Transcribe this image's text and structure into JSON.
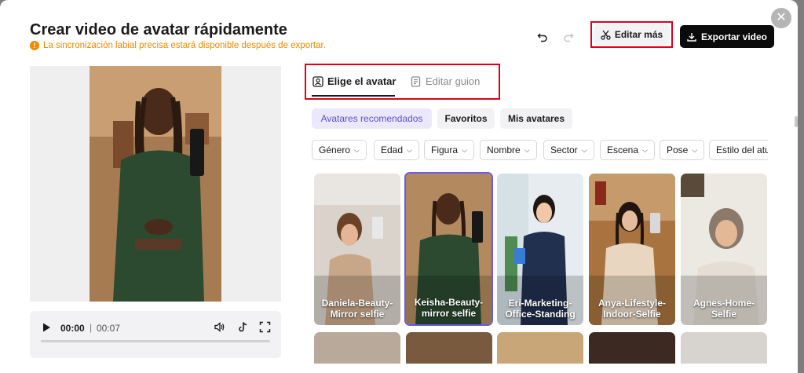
{
  "header": {
    "title": "Crear video de avatar rápidamente",
    "warning": "La sincronización labial precisa estará disponible después de exportar.",
    "edit_more_label": "Editar más",
    "export_label": "Exportar video"
  },
  "player": {
    "current_time": "00:00",
    "separator": "|",
    "total_time": "00:07",
    "progress": 0
  },
  "tabs": [
    {
      "label": "Elige el avatar",
      "active": true
    },
    {
      "label": "Editar guion",
      "active": false
    }
  ],
  "categories": [
    {
      "label": "Avatares recomendados",
      "active": true
    },
    {
      "label": "Favoritos",
      "active": false
    },
    {
      "label": "Mis avatares",
      "active": false
    }
  ],
  "filters": [
    "Género",
    "Edad",
    "Figura",
    "Nombre",
    "Sector",
    "Escena",
    "Pose",
    "Estilo del atuendo"
  ],
  "avatars": [
    {
      "name": "Daniela-Beauty-Mirror selfie",
      "line1": "Daniela-Beauty-",
      "line2": "Mirror selfie",
      "selected": false
    },
    {
      "name": "Keisha-Beauty-mirror selfie",
      "line1": "Keisha-Beauty-",
      "line2": "mirror selfie",
      "selected": true
    },
    {
      "name": "Eri-Marketing-Office-Standing",
      "line1": "Eri-Marketing-",
      "line2": "Office-Standing",
      "selected": false
    },
    {
      "name": "Anya-Lifestyle-Indoor-Selfie",
      "line1": "Anya-Lifestyle-",
      "line2": "Indoor-Selfie",
      "selected": false
    },
    {
      "name": "Agnes-Home-Selfie",
      "line1": "Agnes-Home-",
      "line2": "Selfie",
      "selected": false
    }
  ],
  "colors": {
    "accent": "#6a5ce0",
    "highlight_box": "#e0001b",
    "warning": "#f08a00",
    "export_bg": "#0b0b0b"
  },
  "icons": {
    "close": "close-icon",
    "undo": "undo-icon",
    "redo": "redo-icon",
    "scissors": "scissors-icon",
    "download": "download-icon",
    "play": "play-icon",
    "volume": "volume-icon",
    "tiktok": "tiktok-icon",
    "fullscreen": "fullscreen-icon"
  }
}
